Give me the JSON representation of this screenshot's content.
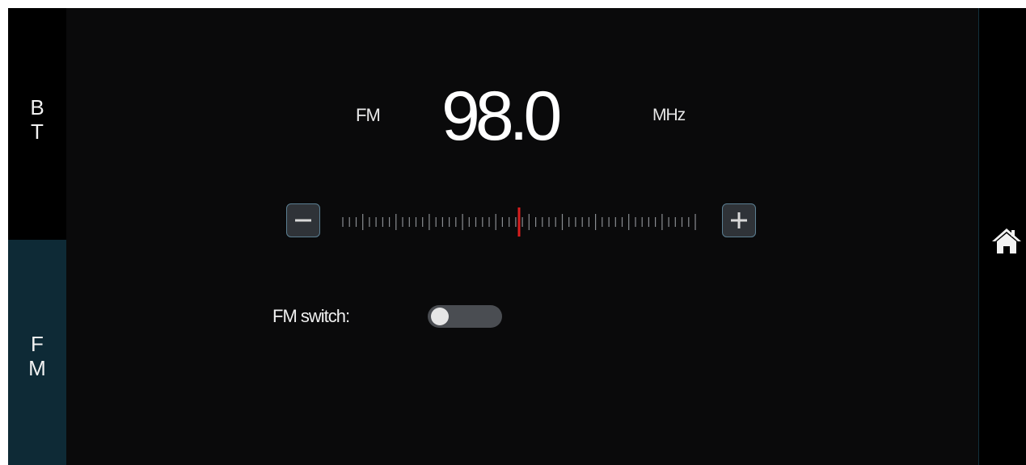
{
  "tabs": {
    "bt_label": "BT",
    "fm_label": "FM",
    "active": "FM"
  },
  "tuner": {
    "band": "FM",
    "frequency": "98.0",
    "unit": "MHz",
    "dial_position": 0.5
  },
  "controls": {
    "minus_icon": "minus-icon",
    "plus_icon": "plus-icon"
  },
  "fm_switch": {
    "label": "FM switch:",
    "on": false
  },
  "home": {
    "icon": "home-icon"
  },
  "colors": {
    "background": "#0a0a0b",
    "active_tab": "#0e2a36",
    "needle": "#d81e1e",
    "button_border": "#5b7f92"
  }
}
